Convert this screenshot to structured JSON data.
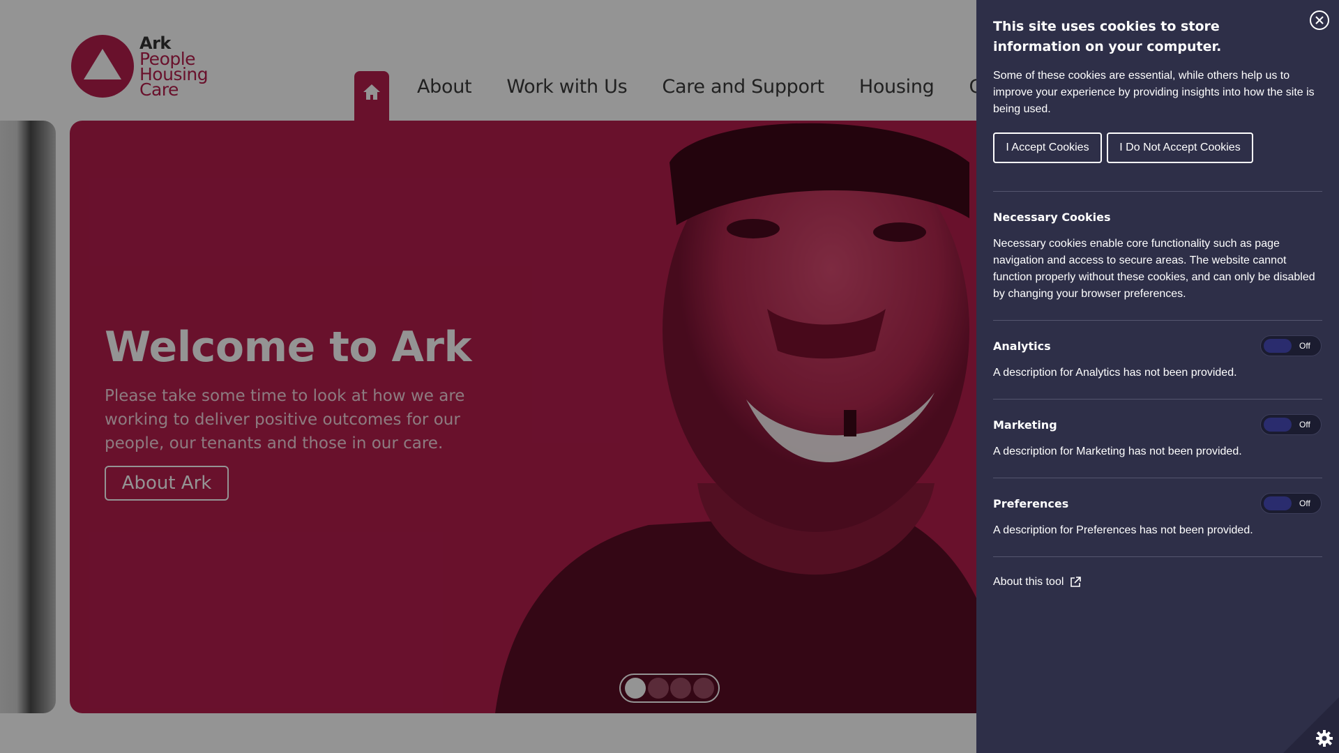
{
  "site": {
    "logo": {
      "line1": "Ark",
      "line2": "People",
      "line3": "Housing",
      "line4": "Care"
    },
    "nav": {
      "home_icon": "home-icon",
      "items": [
        "About",
        "Work with Us",
        "Care and Support",
        "Housing",
        "Get I"
      ]
    },
    "hero": {
      "title": "Welcome to Ark",
      "text": "Please take some time to look at how we are working to deliver positive outcomes for our people, our tenants and those in our care.",
      "button": "About Ark",
      "slide_count": 4,
      "active_slide": 1
    },
    "colors": {
      "brand": "#b51e4d",
      "panel": "#2e2f48"
    }
  },
  "cookie_panel": {
    "title": "This site uses cookies to store information on your computer.",
    "intro": "Some of these cookies are essential, while others help us to improve your experience by providing insights into how the site is being used.",
    "accept_label": "I Accept Cookies",
    "decline_label": "I Do Not Accept Cookies",
    "necessary": {
      "title": "Necessary Cookies",
      "description": "Necessary cookies enable core functionality such as page navigation and access to secure areas. The website cannot function properly without these cookies, and can only be disabled by changing your browser preferences."
    },
    "categories": [
      {
        "title": "Analytics",
        "description": "A description for Analytics has not been provided.",
        "state": "Off"
      },
      {
        "title": "Marketing",
        "description": "A description for Marketing has not been provided.",
        "state": "Off"
      },
      {
        "title": "Preferences",
        "description": "A description for Preferences has not been provided.",
        "state": "Off"
      }
    ],
    "about_link": "About this tool",
    "icons": {
      "close": "close-icon",
      "external": "external-link-icon",
      "settings": "gear-icon"
    }
  }
}
